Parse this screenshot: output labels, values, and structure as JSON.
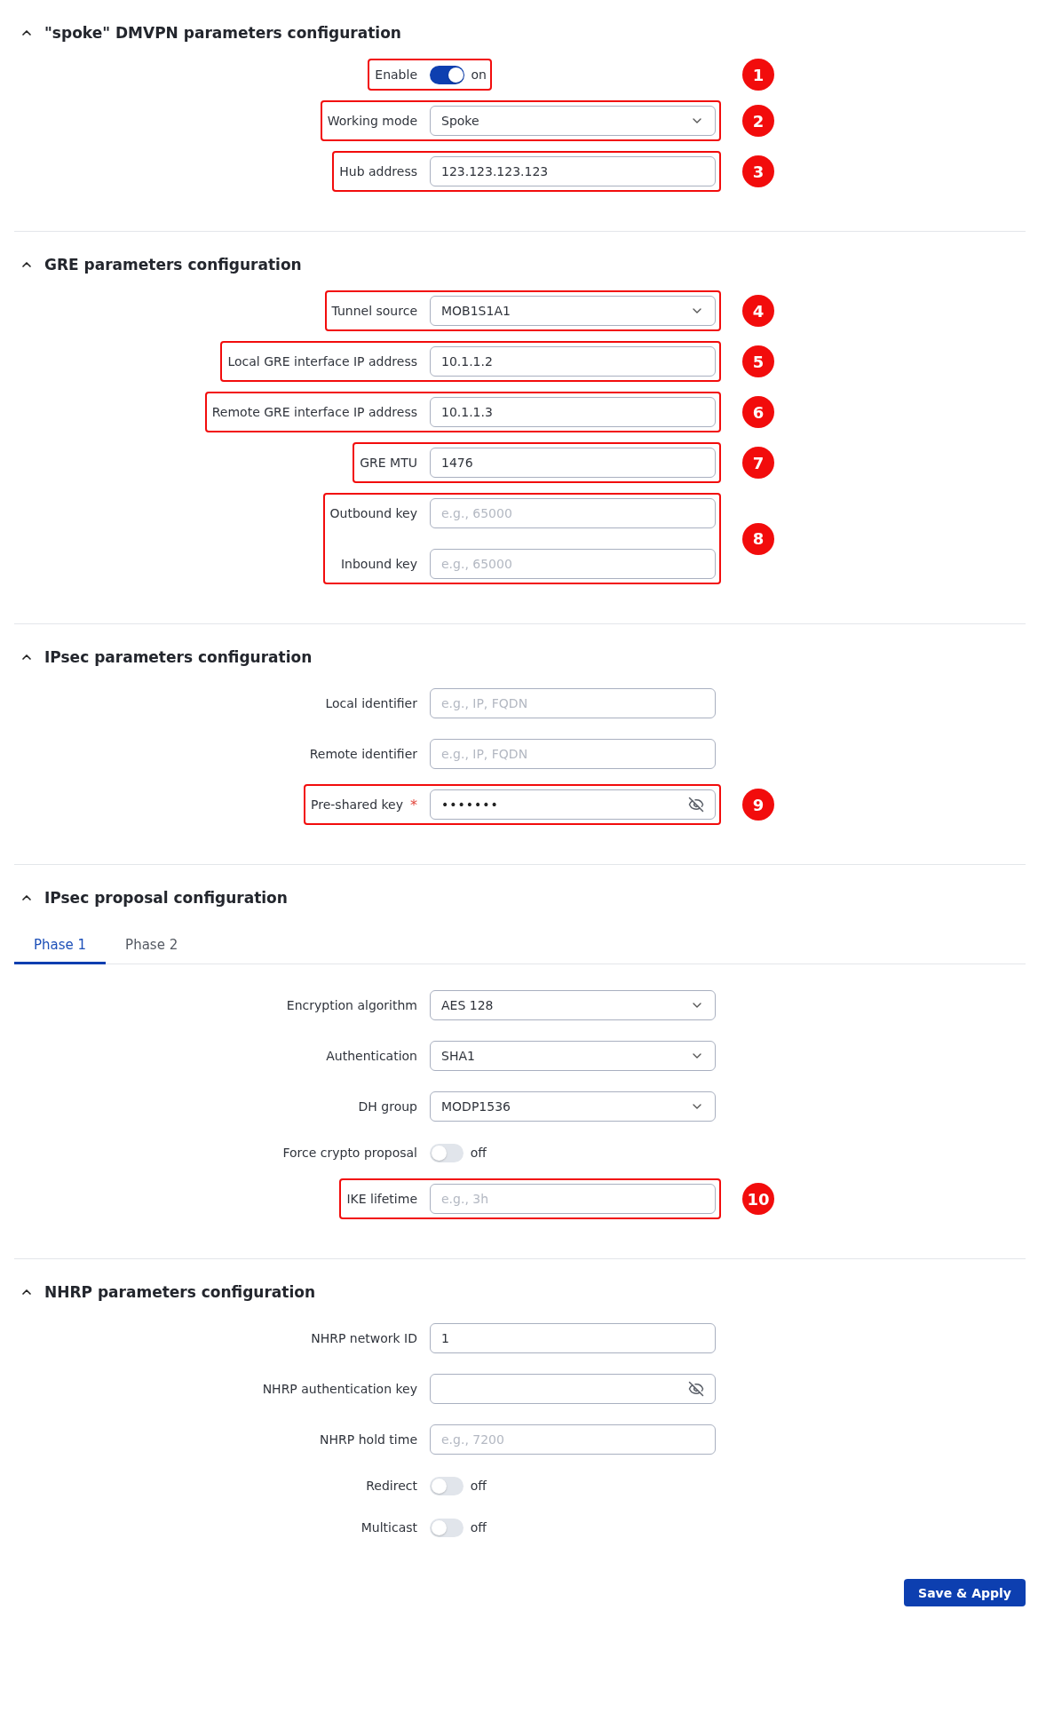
{
  "sections": [
    {
      "title": "\"spoke\" DMVPN parameters configuration",
      "expanded": true,
      "groups": [
        {
          "callout": "1",
          "rows": [
            {
              "kind": "toggle",
              "label": "Enable",
              "on": true,
              "state_text": "on"
            }
          ]
        },
        {
          "callout": "2",
          "rows": [
            {
              "kind": "select",
              "label": "Working mode",
              "value": "Spoke"
            }
          ]
        },
        {
          "callout": "3",
          "rows": [
            {
              "kind": "input",
              "label": "Hub address",
              "value": "123.123.123.123"
            }
          ]
        }
      ]
    },
    {
      "title": "GRE parameters configuration",
      "expanded": true,
      "groups": [
        {
          "callout": "4",
          "rows": [
            {
              "kind": "select",
              "label": "Tunnel source",
              "value": "MOB1S1A1"
            }
          ]
        },
        {
          "callout": "5",
          "rows": [
            {
              "kind": "input",
              "label": "Local GRE interface IP address",
              "value": "10.1.1.2"
            }
          ]
        },
        {
          "callout": "6",
          "rows": [
            {
              "kind": "input",
              "label": "Remote GRE interface IP address",
              "value": "10.1.1.3"
            }
          ]
        },
        {
          "callout": "7",
          "rows": [
            {
              "kind": "input",
              "label": "GRE MTU",
              "value": "1476"
            }
          ]
        },
        {
          "callout": "8",
          "rows": [
            {
              "kind": "input",
              "label": "Outbound key",
              "placeholder": "e.g., 65000"
            },
            {
              "kind": "input",
              "label": "Inbound key",
              "placeholder": "e.g., 65000"
            }
          ]
        }
      ]
    },
    {
      "title": "IPsec parameters configuration",
      "expanded": true,
      "groups": [
        {
          "rows": [
            {
              "kind": "input",
              "label": "Local identifier",
              "placeholder": "e.g., IP, FQDN"
            }
          ]
        },
        {
          "rows": [
            {
              "kind": "input",
              "label": "Remote identifier",
              "placeholder": "e.g., IP, FQDN"
            }
          ]
        },
        {
          "callout": "9",
          "rows": [
            {
              "kind": "password",
              "label": "Pre-shared key",
              "required_mark": "*",
              "value": "•••••••"
            }
          ]
        }
      ]
    },
    {
      "title": "IPsec proposal configuration",
      "expanded": true,
      "tabs": [
        {
          "label": "Phase 1",
          "selected": true
        },
        {
          "label": "Phase 2",
          "selected": false
        }
      ],
      "groups": [
        {
          "rows": [
            {
              "kind": "select",
              "label": "Encryption algorithm",
              "value": "AES 128"
            }
          ]
        },
        {
          "rows": [
            {
              "kind": "select",
              "label": "Authentication",
              "value": "SHA1"
            }
          ]
        },
        {
          "rows": [
            {
              "kind": "select",
              "label": "DH group",
              "value": "MODP1536"
            }
          ]
        },
        {
          "rows": [
            {
              "kind": "toggle",
              "label": "Force crypto proposal",
              "on": false,
              "state_text": "off"
            }
          ]
        },
        {
          "callout": "10",
          "rows": [
            {
              "kind": "input",
              "label": "IKE lifetime",
              "placeholder": "e.g., 3h"
            }
          ]
        }
      ]
    },
    {
      "title": "NHRP parameters configuration",
      "expanded": true,
      "groups": [
        {
          "rows": [
            {
              "kind": "input",
              "label": "NHRP network ID",
              "value": "1"
            }
          ]
        },
        {
          "rows": [
            {
              "kind": "password",
              "label": "NHRP authentication key"
            }
          ]
        },
        {
          "rows": [
            {
              "kind": "input",
              "label": "NHRP hold time",
              "placeholder": "e.g., 7200"
            }
          ]
        },
        {
          "rows": [
            {
              "kind": "toggle",
              "label": "Redirect",
              "on": false,
              "state_text": "off"
            }
          ]
        },
        {
          "rows": [
            {
              "kind": "toggle",
              "label": "Multicast",
              "on": false,
              "state_text": "off"
            }
          ]
        }
      ]
    }
  ],
  "save_button": "Save & Apply"
}
